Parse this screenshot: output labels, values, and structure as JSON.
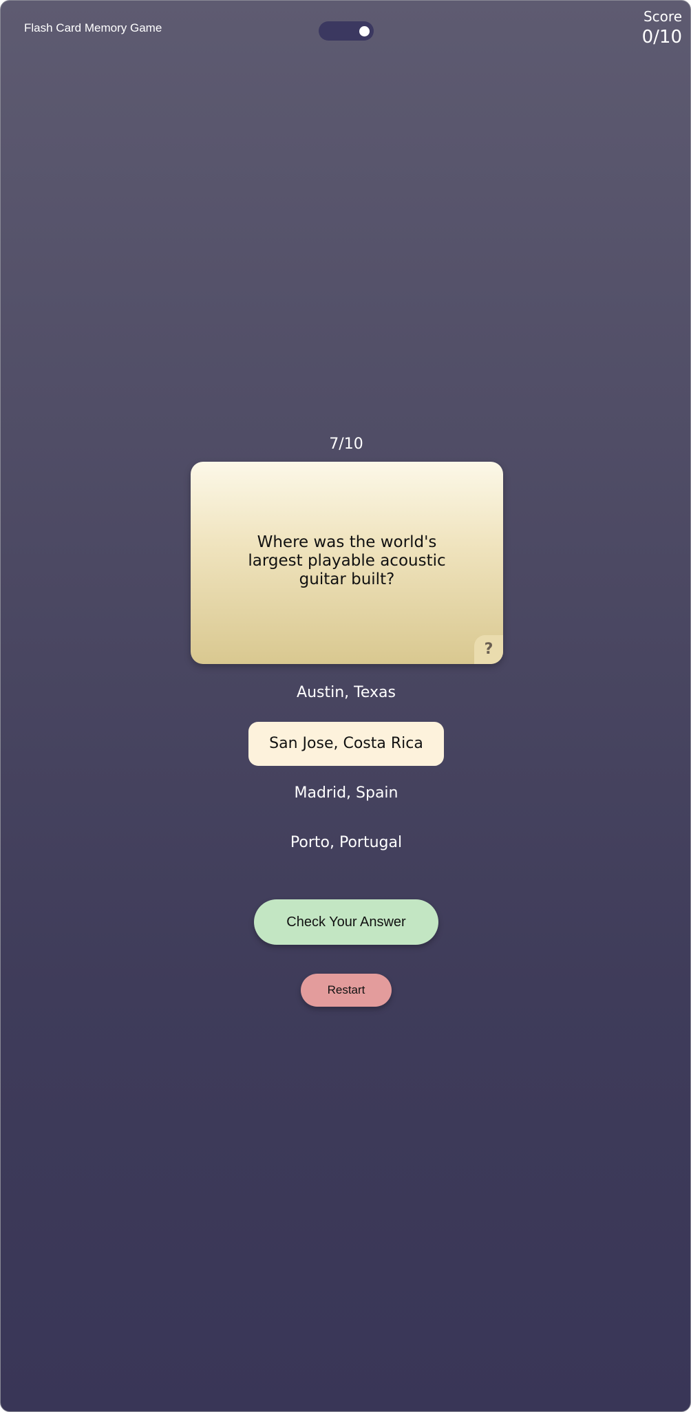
{
  "header": {
    "title": "Flash Card Memory Game",
    "theme_toggle_icon": "toggle-switch-icon",
    "score_label": "Score",
    "score_value": "0/10"
  },
  "quiz": {
    "progress": "7/10",
    "question": "Where was the world's largest playable acoustic guitar built?",
    "hint_icon": "?",
    "options": [
      {
        "label": "Austin, Texas",
        "selected": false
      },
      {
        "label": "San Jose, Costa Rica",
        "selected": true
      },
      {
        "label": "Madrid, Spain",
        "selected": false
      },
      {
        "label": "Porto, Portugal",
        "selected": false
      }
    ]
  },
  "actions": {
    "check_label": "Check Your Answer",
    "restart_label": "Restart"
  },
  "colors": {
    "background_top": "#5e5b71",
    "background_bottom": "#393657",
    "card_top": "#fcf8e8",
    "card_bottom": "#d9c890",
    "selected_option": "#fdf2dc",
    "check_button": "#c3e6c3",
    "restart_button": "#e39c9c"
  }
}
